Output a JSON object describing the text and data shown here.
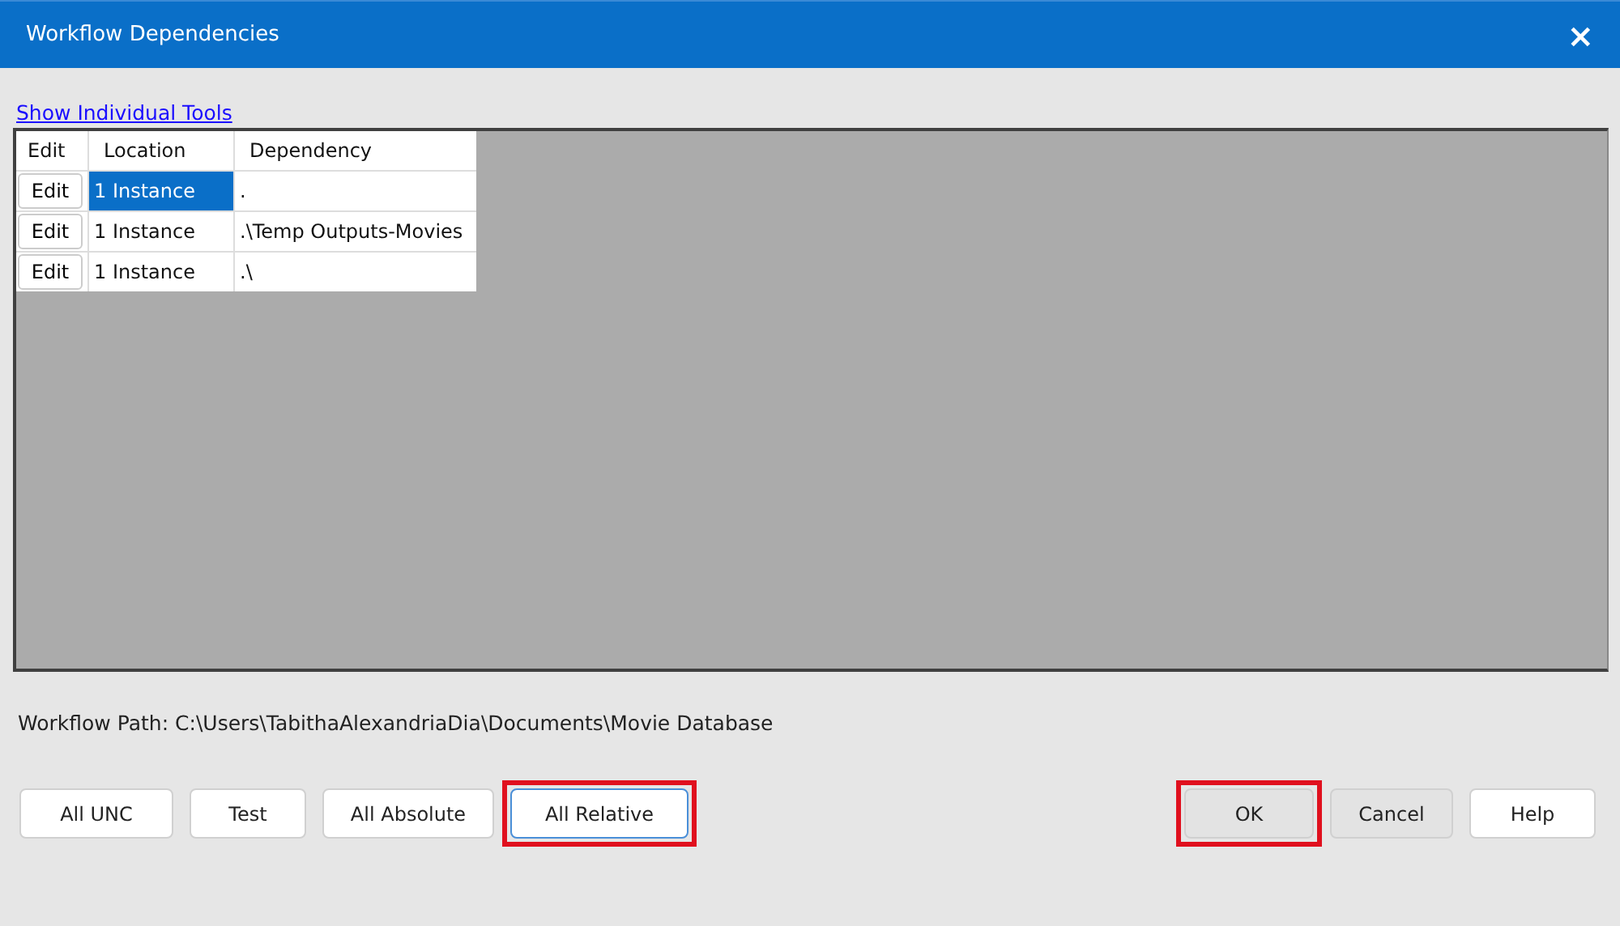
{
  "window": {
    "title": "Workflow Dependencies",
    "close": "×"
  },
  "link": "Show Individual Tools",
  "table": {
    "columns": [
      "Edit",
      "Location",
      "Dependency"
    ],
    "rows": [
      {
        "edit": "Edit",
        "location": "1 Instance",
        "dependency": ".",
        "selected": true
      },
      {
        "edit": "Edit",
        "location": "1 Instance",
        "dependency": ".\\Temp Outputs-Movies",
        "selected": false
      },
      {
        "edit": "Edit",
        "location": "1 Instance",
        "dependency": ".\\",
        "selected": false
      }
    ]
  },
  "workflow_path": "Workflow Path: C:\\Users\\TabithaAlexandriaDia\\Documents\\Movie Database",
  "left_buttons": [
    {
      "label": "All UNC",
      "kind": "white",
      "focused": false,
      "highlighted": false
    },
    {
      "label": "Test",
      "kind": "white",
      "focused": false,
      "highlighted": false
    },
    {
      "label": "All Absolute",
      "kind": "white",
      "focused": false,
      "highlighted": false
    },
    {
      "label": "All Relative",
      "kind": "white",
      "focused": true,
      "highlighted": true
    }
  ],
  "right_buttons": [
    {
      "label": "OK",
      "kind": "shaded",
      "focused": false,
      "highlighted": true
    },
    {
      "label": "Cancel",
      "kind": "shaded",
      "focused": false,
      "highlighted": false
    },
    {
      "label": "Help",
      "kind": "white",
      "focused": false,
      "highlighted": false
    }
  ]
}
